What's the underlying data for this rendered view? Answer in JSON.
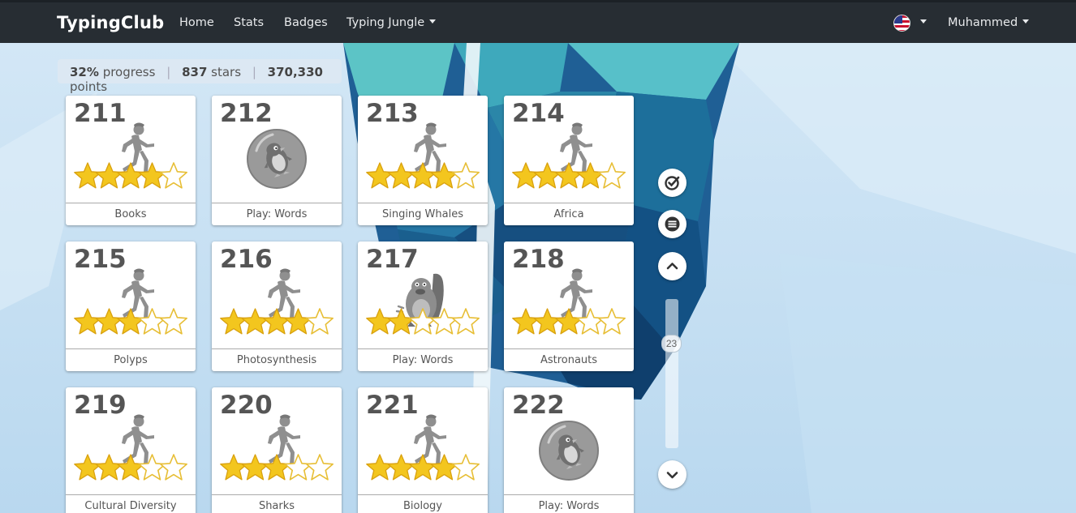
{
  "nav": {
    "brand": "TypingClub",
    "links": [
      "Home",
      "Stats",
      "Badges",
      "Typing Jungle"
    ],
    "user": "Muhammed",
    "language_icon": "us-flag-icon"
  },
  "progress": {
    "percent": "32%",
    "percent_label": "progress",
    "stars": "837",
    "stars_label": "stars",
    "points": "370,330",
    "points_label": "points"
  },
  "lessons": [
    {
      "number": "211",
      "title": "Books",
      "icon": "runner-icon",
      "stars": 4
    },
    {
      "number": "212",
      "title": "Play: Words",
      "icon": "penguin-game-icon",
      "stars": 0
    },
    {
      "number": "213",
      "title": "Singing Whales",
      "icon": "runner-icon",
      "stars": 4
    },
    {
      "number": "214",
      "title": "Africa",
      "icon": "runner-icon",
      "stars": 4
    },
    {
      "number": "215",
      "title": "Polyps",
      "icon": "runner-icon",
      "stars": 3
    },
    {
      "number": "216",
      "title": "Photosynthesis",
      "icon": "runner-icon",
      "stars": 4
    },
    {
      "number": "217",
      "title": "Play: Words",
      "icon": "monster-game-icon",
      "stars": 2
    },
    {
      "number": "218",
      "title": "Astronauts",
      "icon": "runner-icon",
      "stars": 3
    },
    {
      "number": "219",
      "title": "Cultural Diversity",
      "icon": "runner-icon",
      "stars": 3
    },
    {
      "number": "220",
      "title": "Sharks",
      "icon": "runner-icon",
      "stars": 3
    },
    {
      "number": "221",
      "title": "Biology",
      "icon": "runner-icon",
      "stars": 4
    },
    {
      "number": "222",
      "title": "Play: Words",
      "icon": "penguin-game-icon",
      "stars": 0
    }
  ],
  "controls": {
    "scroll_position": "23",
    "icons": [
      "check-circle-icon",
      "menu-icon",
      "chevron-up-icon",
      "chevron-down-icon"
    ]
  },
  "colors": {
    "navbar": "#272d33",
    "star_fill": "#f3c61e",
    "card_text": "#555555"
  }
}
